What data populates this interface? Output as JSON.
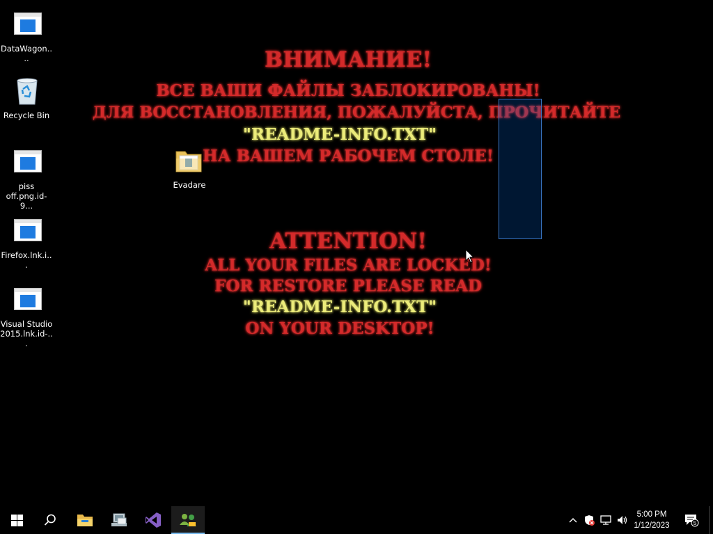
{
  "desktop": {
    "icons": [
      {
        "label": "DataWagon...."
      },
      {
        "label": "Recycle Bin"
      },
      {
        "label": "piss off.png.id-9..."
      },
      {
        "label": "Firefox.lnk.i..."
      },
      {
        "label": "Visual Studio 2015.lnk.id-..."
      },
      {
        "label": "Evadare"
      }
    ]
  },
  "ransom": {
    "ru_title": "ВНИМАНИЕ!",
    "ru_line1": "ВСЕ ВАШИ ФАЙЛЫ ЗАБЛОКИРОВАНЫ!",
    "ru_line2": "ДЛЯ ВОССТАНОВЛЕНИЯ, ПОЖАЛУЙСТА, ПРОЧИТАЙТЕ",
    "ru_file": "\"README-INFO.TXT\"",
    "ru_line3": "НА ВАШЕМ РАБОЧЕМ СТОЛЕ!",
    "en_title": "ATTENTION!",
    "en_line1": "ALL YOUR FILES ARE LOCKED!",
    "en_line2": "FOR RESTORE PLEASE READ",
    "en_file": "\"README-INFO.TXT\"",
    "en_line3": "ON YOUR DESKTOP!"
  },
  "taskbar": {
    "icons": [
      "windows-start-icon",
      "search-icon",
      "file-explorer-icon",
      "network-manager-icon",
      "visual-studio-icon",
      "users-icon"
    ],
    "tray_icons": [
      "chevron-up-icon",
      "security-alert-icon",
      "network-icon",
      "volume-icon"
    ],
    "time": "5:00 PM",
    "date": "1/12/2023",
    "notification_count": "5",
    "colors": {
      "accent": "#76b9ed",
      "message_red": "#d42a2a",
      "message_yellow": "#ecec7a"
    }
  }
}
